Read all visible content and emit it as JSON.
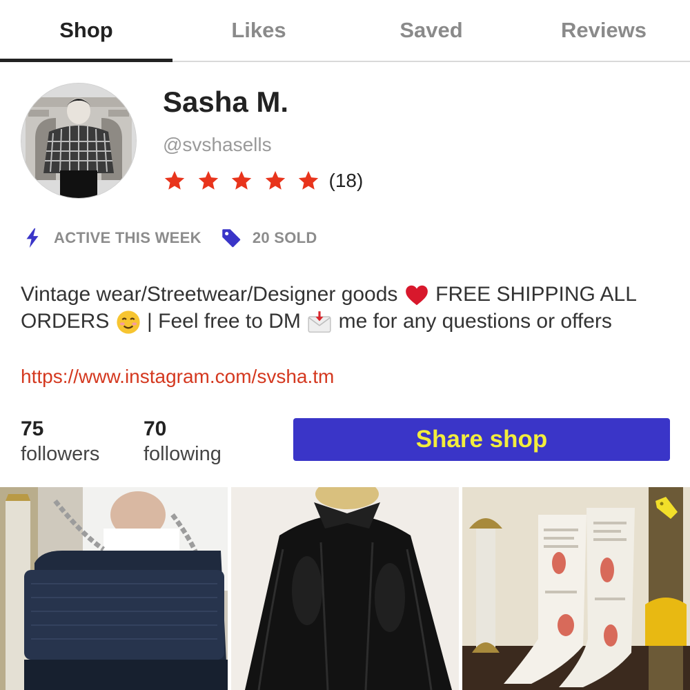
{
  "tabs": [
    {
      "label": "Shop",
      "active": true
    },
    {
      "label": "Likes",
      "active": false
    },
    {
      "label": "Saved",
      "active": false
    },
    {
      "label": "Reviews",
      "active": false
    }
  ],
  "profile": {
    "name": "Sasha M.",
    "handle": "@svshasells",
    "rating_stars": 5,
    "rating_count": "(18)",
    "star_color": "#e8341c"
  },
  "badges": {
    "activity_label": "ACTIVE THIS WEEK",
    "sold_label": "20 SOLD",
    "icon_color": "#3a35c8"
  },
  "bio": {
    "part1": "Vintage wear/Streetwear/Designer goods",
    "emoji1": "heart-emoji",
    "part2": "FREE SHIPPING ALL ORDERS",
    "emoji2": "smiling-face-emoji",
    "part3": "| Feel free to DM",
    "emoji3": "envelope-emoji",
    "part4": "me for any questions or offers",
    "link": "https://www.instagram.com/svsha.tm"
  },
  "stats": {
    "followers_count": "75",
    "followers_label": "followers",
    "following_count": "70",
    "following_label": "following"
  },
  "share_button": {
    "label": "Share shop",
    "bg_color": "#3a35c8",
    "text_color": "#f2ed3c"
  },
  "listings": [
    {
      "icon": "navy-shoulder-bag-photo"
    },
    {
      "icon": "black-leather-jacket-photo"
    },
    {
      "icon": "newspaper-print-boots-photo",
      "tag_icon": "price-tag-icon"
    }
  ]
}
